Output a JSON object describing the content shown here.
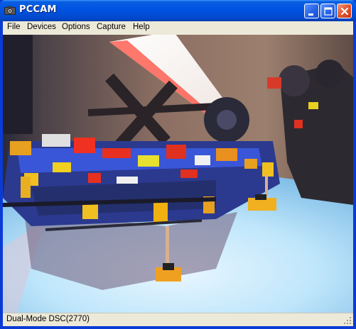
{
  "window": {
    "title": "PCCAM",
    "icon": "camera-app-icon",
    "buttons": [
      "minimize-icon",
      "maximize-icon",
      "close-icon"
    ]
  },
  "menu": {
    "file": "File",
    "devices": "Devices",
    "options": "Options",
    "capture": "Capture",
    "help": "Help"
  },
  "video": {
    "description_icon": "webcam-preview"
  },
  "status": {
    "device": "Dual-Mode DSC(2770)"
  },
  "colors": {
    "titlebar": "#0054e3",
    "chrome": "#ece9d8",
    "close_button": "#e3562f"
  }
}
